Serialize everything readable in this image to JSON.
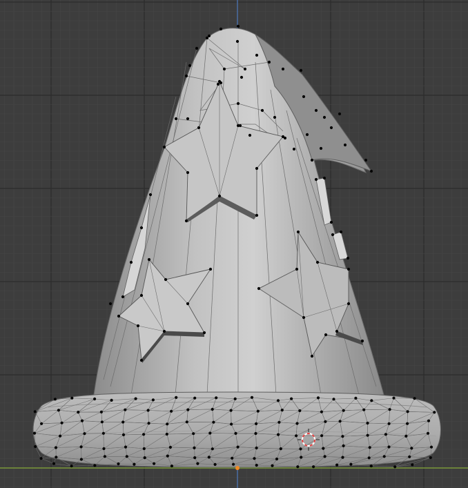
{
  "viewport": {
    "background_color": "#3d3d3d",
    "grid_minor_color": "#474747",
    "grid_major_color": "#2c2c2c",
    "axis_x_color": "#7c9b3a",
    "axis_z_color": "#4a6fa5",
    "origin_dot_color": "#f08a24",
    "mesh_fill_color": "#b4b4b4",
    "mesh_shadow_color": "#9a9a9a",
    "mesh_light_color": "#cfcfcf",
    "mesh_edge_color": "#5e5e5e",
    "vertex_color": "#050505",
    "cursor_ring_colors": [
      "#e04040",
      "#ffffff"
    ]
  },
  "objects": [
    {
      "name": "wizard-hat",
      "mode": "edit-mode",
      "selected_vertices_shown": true
    }
  ],
  "scene_elements": [
    "3d-cursor",
    "world-origin",
    "x-axis-line",
    "z-axis-line"
  ]
}
